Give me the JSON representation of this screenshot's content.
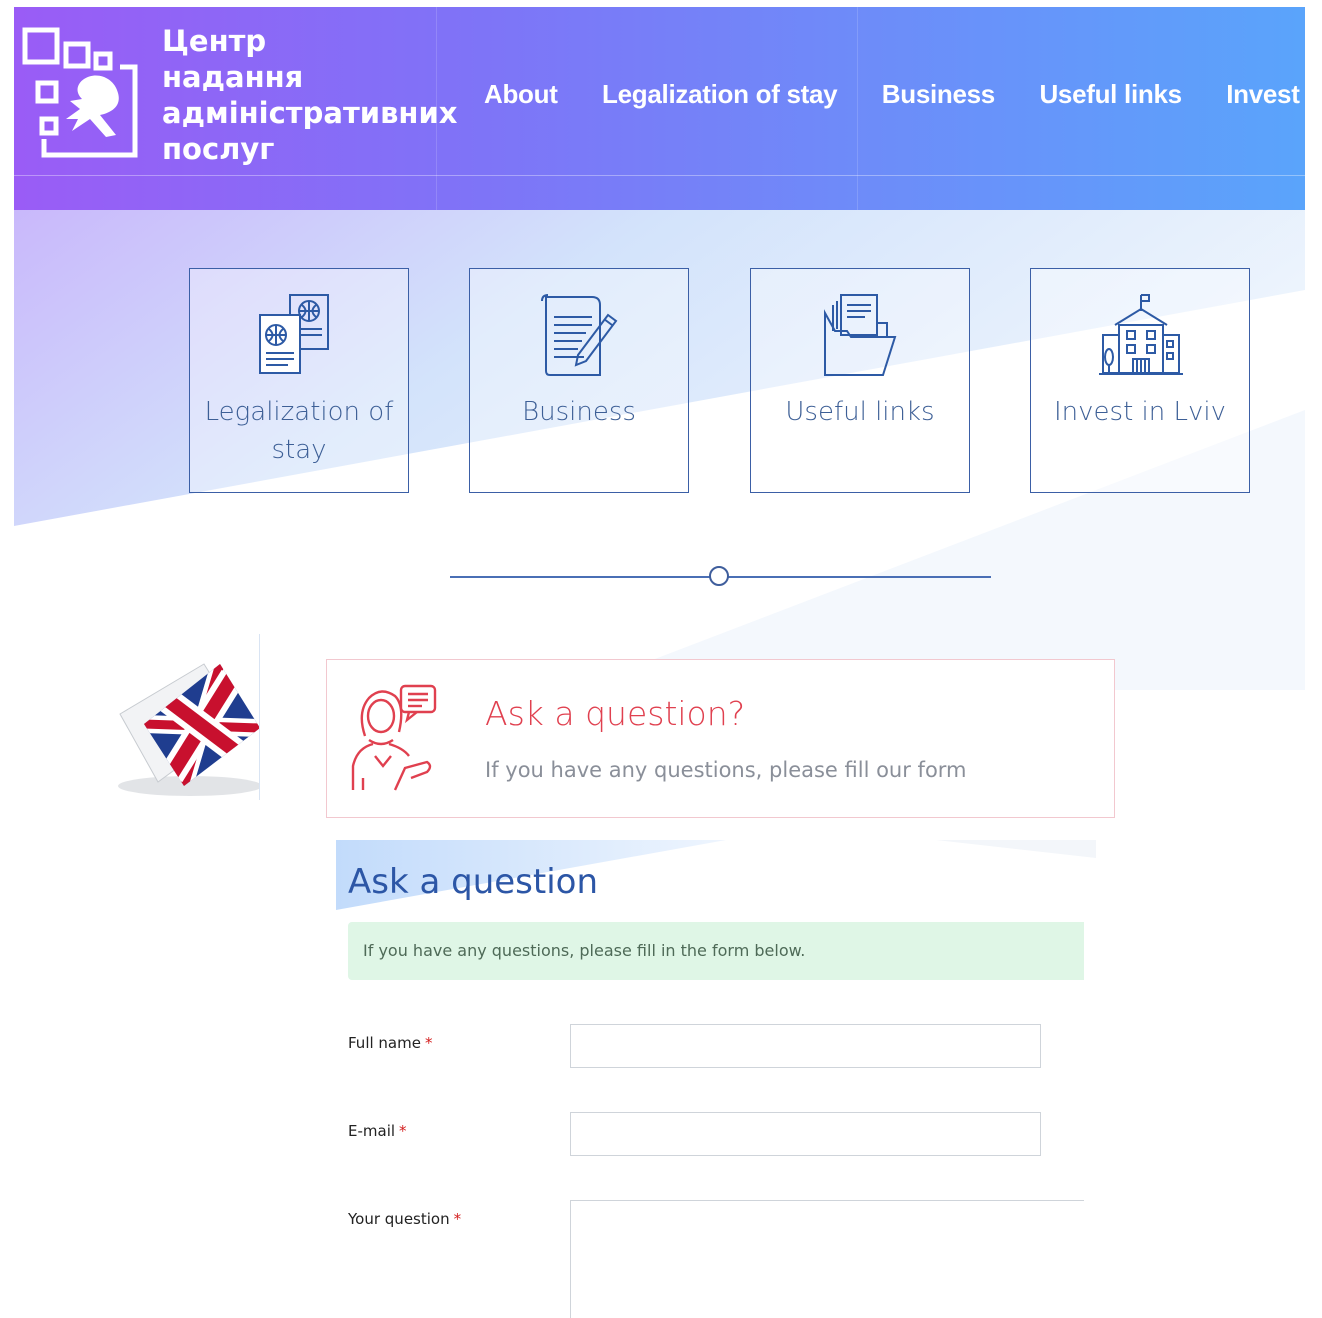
{
  "header": {
    "brand_lines": [
      "Центр",
      "надання",
      "адміністративних",
      "послуг"
    ],
    "nav": [
      "About",
      "Legalization of stay",
      "Business",
      "Useful links",
      "Invest in Lv"
    ]
  },
  "cards": [
    {
      "label": "Legalization of stay",
      "icon": "passport-icon"
    },
    {
      "label": "Business",
      "icon": "document-pen-icon"
    },
    {
      "label": "Useful links",
      "icon": "folder-icon"
    },
    {
      "label": "Invest in Lviv",
      "icon": "city-hall-icon"
    }
  ],
  "ask_panel": {
    "title": "Ask a question?",
    "subtitle": "If you have any questions, please fill our form"
  },
  "form": {
    "title": "Ask a question",
    "info": "If you have any questions, please fill in the form below.",
    "fields": [
      {
        "label": "Full name",
        "required": "*",
        "value": ""
      },
      {
        "label": "E-mail",
        "required": "*",
        "value": ""
      },
      {
        "label": "Your question",
        "required": "*",
        "value": ""
      }
    ]
  },
  "colors": {
    "header_start": "#9a5cf6",
    "header_end": "#5aa4fb",
    "card_border": "#3b5fa6",
    "ask_title": "#e0404f",
    "form_title": "#2c56a6",
    "info_bg": "#dff6e6",
    "required": "#d31e1e"
  }
}
